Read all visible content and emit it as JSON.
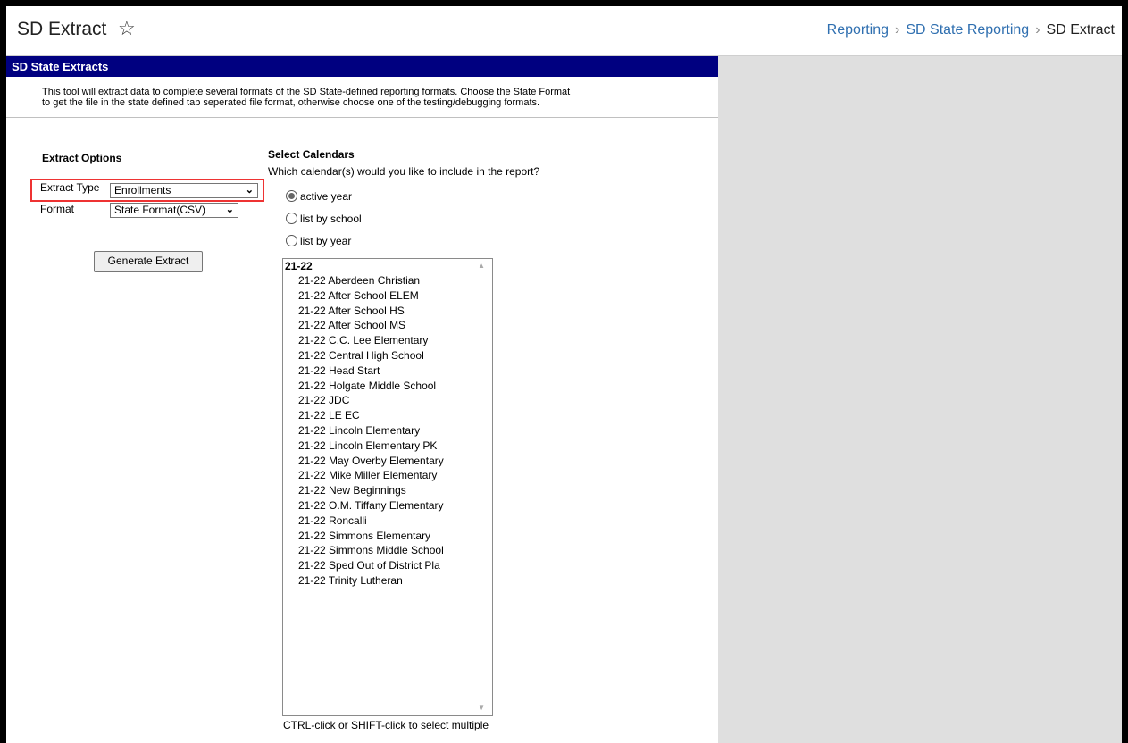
{
  "header": {
    "title": "SD Extract",
    "breadcrumb": [
      "Reporting",
      "SD State Reporting",
      "SD Extract"
    ]
  },
  "panel": {
    "title": "SD State Extracts",
    "intro_line1": "This tool will extract data to complete several formats of the SD State-defined reporting formats. Choose the State Format",
    "intro_line2": "to get the file in the state defined tab seperated file format, otherwise choose one of the testing/debugging formats."
  },
  "options": {
    "title": "Extract Options",
    "type_label": "Extract Type",
    "type_value": "Enrollments",
    "format_label": "Format",
    "format_value": "State Format(CSV)",
    "generate_label": "Generate Extract"
  },
  "calendars": {
    "title": "Select Calendars",
    "question": "Which calendar(s) would you like to include in the report?",
    "radios": [
      "active year",
      "list by school",
      "list by year"
    ],
    "selected_radio": "active year",
    "group": "21-22",
    "items": [
      "21-22 Aberdeen Christian",
      "21-22 After School ELEM",
      "21-22 After School HS",
      "21-22 After School MS",
      "21-22 C.C. Lee Elementary",
      "21-22 Central High School",
      "21-22 Head Start",
      "21-22 Holgate Middle School",
      "21-22 JDC",
      "21-22 LE EC",
      "21-22 Lincoln Elementary",
      "21-22 Lincoln Elementary PK",
      "21-22 May Overby Elementary",
      "21-22 Mike Miller Elementary",
      "21-22 New Beginnings",
      "21-22 O.M. Tiffany Elementary",
      "21-22 Roncalli",
      "21-22 Simmons Elementary",
      "21-22 Simmons Middle School",
      "21-22 Sped Out of District Pla",
      "21-22 Trinity Lutheran"
    ],
    "hint": "CTRL-click or SHIFT-click to select multiple"
  }
}
